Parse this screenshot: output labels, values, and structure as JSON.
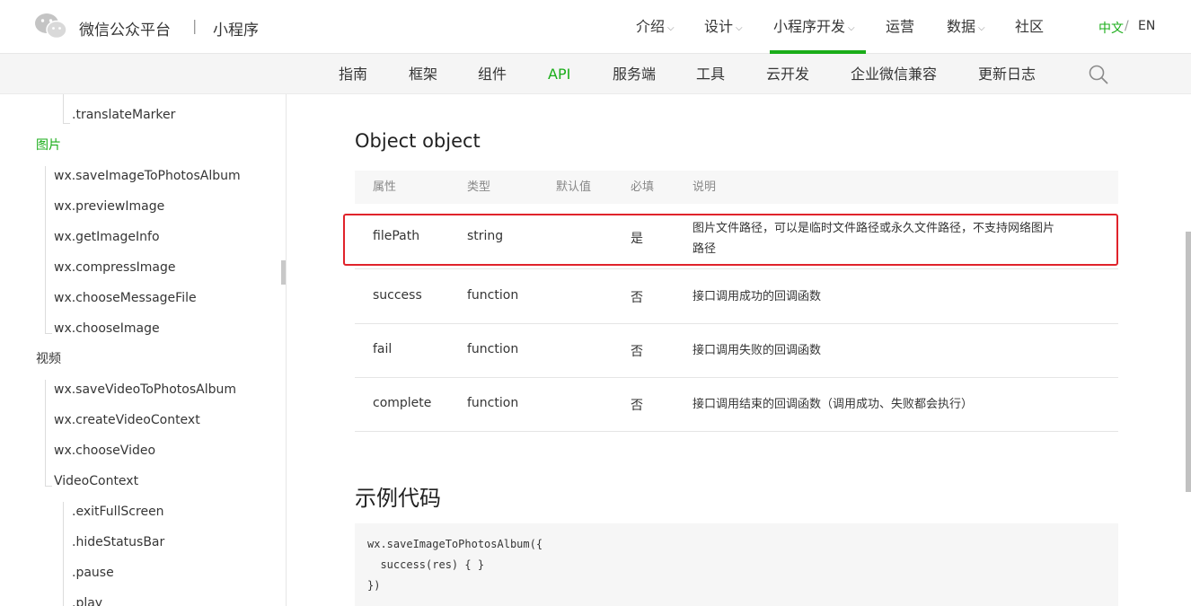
{
  "header": {
    "brand": "微信公众平台",
    "separator": "|",
    "sub_brand": "小程序",
    "nav": [
      {
        "label": "介绍",
        "has_dropdown": true
      },
      {
        "label": "设计",
        "has_dropdown": true
      },
      {
        "label": "小程序开发",
        "has_dropdown": true,
        "active": true
      },
      {
        "label": "运营",
        "has_dropdown": false
      },
      {
        "label": "数据",
        "has_dropdown": true
      },
      {
        "label": "社区",
        "has_dropdown": false
      }
    ],
    "lang": {
      "zh": "中文",
      "slash": "/",
      "en": "EN"
    },
    "chevron": "⌵"
  },
  "subnav": {
    "items": [
      "指南",
      "框架",
      "组件",
      "API",
      "服务端",
      "工具",
      "云开发",
      "企业微信兼容",
      "更新日志"
    ],
    "active": "API",
    "search_icon": "search-icon"
  },
  "sidebar": {
    "items": [
      {
        "label": ".translateMarker",
        "level": 3
      },
      {
        "label": "图片",
        "level": 1,
        "active": true
      },
      {
        "label": "wx.saveImageToPhotosAlbum",
        "level": 2
      },
      {
        "label": "wx.previewImage",
        "level": 2
      },
      {
        "label": "wx.getImageInfo",
        "level": 2
      },
      {
        "label": "wx.compressImage",
        "level": 2
      },
      {
        "label": "wx.chooseMessageFile",
        "level": 2
      },
      {
        "label": "wx.chooseImage",
        "level": 2
      },
      {
        "label": "视频",
        "level": 1
      },
      {
        "label": "wx.saveVideoToPhotosAlbum",
        "level": 2
      },
      {
        "label": "wx.createVideoContext",
        "level": 2
      },
      {
        "label": "wx.chooseVideo",
        "level": 2
      },
      {
        "label": "VideoContext",
        "level": 2
      },
      {
        "label": ".exitFullScreen",
        "level": 3
      },
      {
        "label": ".hideStatusBar",
        "level": 3
      },
      {
        "label": ".pause",
        "level": 3
      },
      {
        "label": ".play",
        "level": 3
      }
    ]
  },
  "main": {
    "section_title": "Object object",
    "table": {
      "headers": [
        "属性",
        "类型",
        "默认值",
        "必填",
        "说明"
      ],
      "rows": [
        {
          "name": "filePath",
          "type": "string",
          "default": "",
          "required": "是",
          "desc": "图片文件路径，可以是临时文件路径或永久文件路径，不支持网络图片",
          "desc2": "路径"
        },
        {
          "name": "success",
          "type": "function",
          "default": "",
          "required": "否",
          "desc": "接口调用成功的回调函数",
          "desc2": ""
        },
        {
          "name": "fail",
          "type": "function",
          "default": "",
          "required": "否",
          "desc": "接口调用失败的回调函数",
          "desc2": ""
        },
        {
          "name": "complete",
          "type": "function",
          "default": "",
          "required": "否",
          "desc": "接口调用结束的回调函数（调用成功、失败都会执行）",
          "desc2": ""
        }
      ]
    },
    "example_title": "示例代码",
    "code_lines": [
      "wx.saveImageToPhotosAlbum({",
      "  success(res) { }",
      "})"
    ]
  },
  "colors": {
    "accent": "#1aad19",
    "highlight": "#e0232b"
  }
}
